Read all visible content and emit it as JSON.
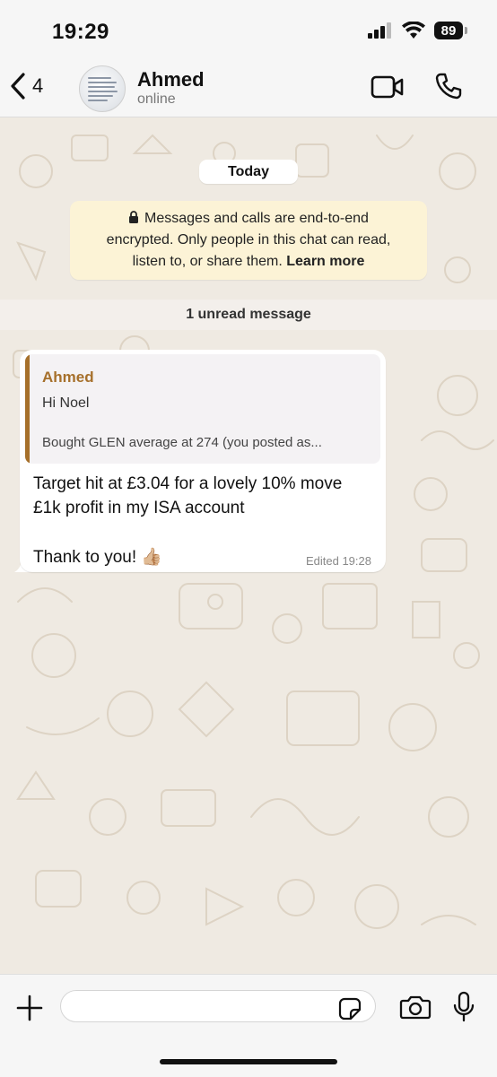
{
  "status_bar": {
    "time": "19:29",
    "battery": "89"
  },
  "header": {
    "back_count": "4",
    "contact_name": "Ahmed",
    "contact_status": "online"
  },
  "chat": {
    "date_label": "Today",
    "encryption_notice": {
      "line1": "Messages and calls are end-to-end",
      "line2": "encrypted. Only people in this chat can read,",
      "line3_prefix": "listen to, or share them.",
      "link": "Learn more"
    },
    "unread_label": "1 unread message",
    "message": {
      "quote": {
        "author": "Ahmed",
        "line1": "Hi Noel",
        "line2": "Bought GLEN average at 274 (you posted as..."
      },
      "lines": [
        "Target hit at £3.04 for a lovely 10% move",
        "£1k profit in my ISA account",
        "Thank to you!"
      ],
      "emoji": "👍🏼",
      "meta": "Edited 19:28"
    }
  },
  "input": {
    "placeholder": ""
  },
  "icons": {
    "back": "chevron-left-icon",
    "video": "video-camera-icon",
    "call": "phone-icon",
    "plus": "plus-icon",
    "sticker": "sticker-icon",
    "camera": "camera-icon",
    "mic": "microphone-icon",
    "lock": "lock-icon"
  },
  "colors": {
    "quote_accent": "#a6702b",
    "notice_bg": "#fcf3d6",
    "wallpaper": "#efeae2"
  }
}
